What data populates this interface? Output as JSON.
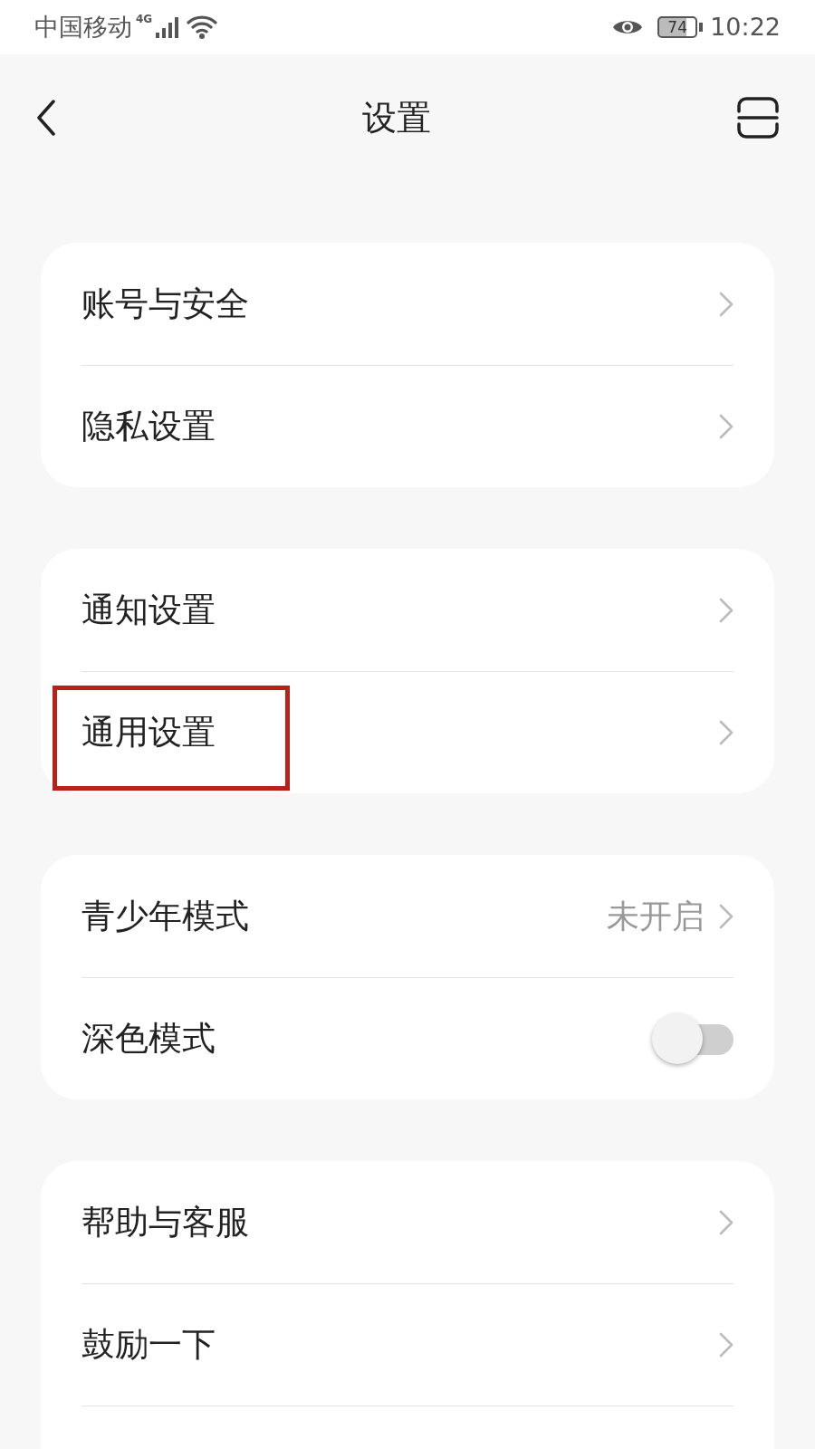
{
  "status_bar": {
    "carrier": "中国移动",
    "network": "4G",
    "battery": "74",
    "time": "10:22"
  },
  "header": {
    "title": "设置"
  },
  "groups": [
    {
      "items": [
        {
          "kind": "link",
          "label": "账号与安全",
          "highlighted": false
        },
        {
          "kind": "link",
          "label": "隐私设置",
          "highlighted": false
        }
      ]
    },
    {
      "items": [
        {
          "kind": "link",
          "label": "通知设置",
          "highlighted": false
        },
        {
          "kind": "link",
          "label": "通用设置",
          "highlighted": true
        }
      ]
    },
    {
      "items": [
        {
          "kind": "link",
          "label": "青少年模式",
          "value": "未开启",
          "highlighted": false
        },
        {
          "kind": "toggle",
          "label": "深色模式",
          "on": false,
          "highlighted": false
        }
      ]
    },
    {
      "items": [
        {
          "kind": "link",
          "label": "帮助与客服",
          "highlighted": false
        },
        {
          "kind": "link",
          "label": "鼓励一下",
          "highlighted": false
        },
        {
          "kind": "cut"
        }
      ]
    }
  ]
}
